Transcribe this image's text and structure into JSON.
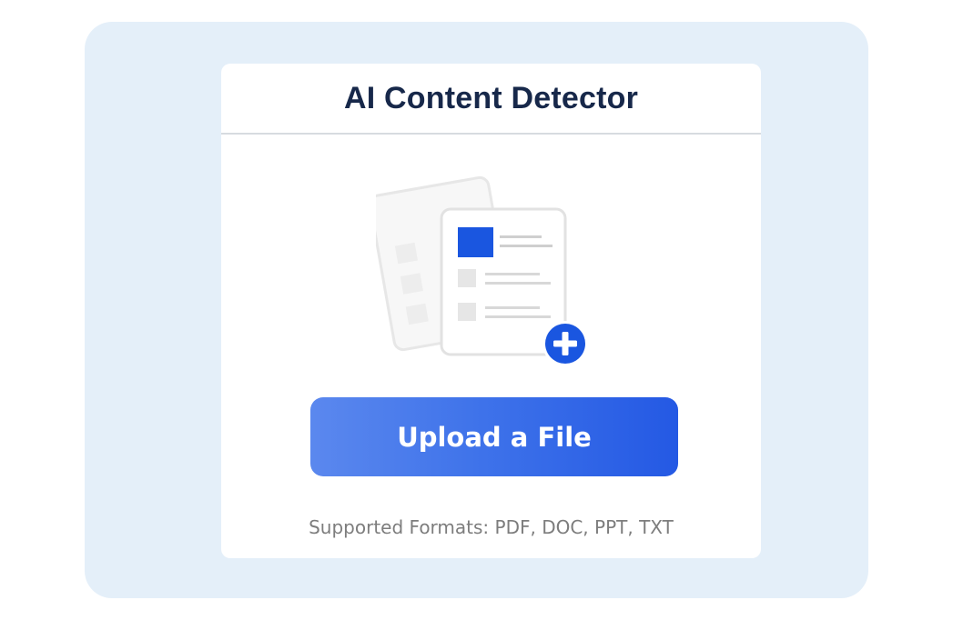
{
  "card": {
    "title": "AI Content Detector"
  },
  "upload": {
    "button_label": "Upload a File",
    "supported_formats": "Supported Formats: PDF, DOC, PPT, TXT"
  },
  "icons": {
    "illustration": "documents-illustration",
    "add": "plus-circle-icon"
  },
  "colors": {
    "background": "#e4eff9",
    "title": "#17284a",
    "accent": "#1e5ae6",
    "button_gradient_start": "#5b88ee",
    "button_gradient_end": "#2459e4"
  }
}
